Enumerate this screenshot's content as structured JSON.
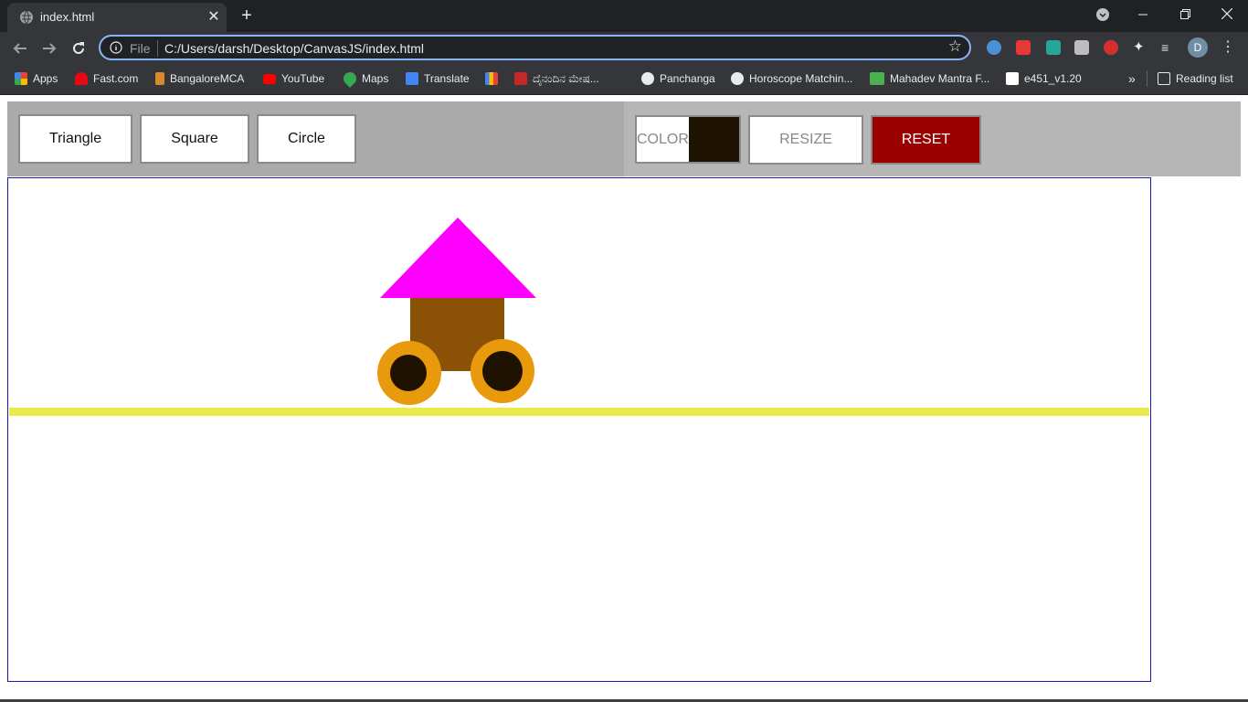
{
  "browser": {
    "tab_title": "index.html",
    "tab_close": "✕",
    "new_tab": "+",
    "omnibox_file_label": "File",
    "omnibox_url": "C:/Users/darsh/Desktop/CanvasJS/index.html",
    "avatar_letter": "D"
  },
  "bookmarks": [
    {
      "label": "Apps",
      "color": "#ea4335"
    },
    {
      "label": "Fast.com",
      "color": "#e50914"
    },
    {
      "label": "BangaloreMCA",
      "color": "#d9892b"
    },
    {
      "label": "YouTube",
      "color": "#ff0000"
    },
    {
      "label": "Maps",
      "color": "#34a853"
    },
    {
      "label": "Translate",
      "color": "#4285f4"
    },
    {
      "label": "",
      "color": "#fbbc04"
    },
    {
      "label": "ದೈನಂದಿನ ಮೇಷ...",
      "color": "#c62828"
    },
    {
      "label": "Panchanga",
      "color": "#e8eaed"
    },
    {
      "label": "Horoscope Matchin...",
      "color": "#e8eaed"
    },
    {
      "label": "Mahadev Mantra F...",
      "color": "#4caf50"
    },
    {
      "label": "e451_v1.20",
      "color": "#ffffff"
    }
  ],
  "bookmarks_more": "»",
  "reading_list": "Reading list",
  "controls": {
    "triangle_label": "Triangle",
    "square_label": "Square",
    "circle_label": "Circle",
    "color_label": "COLOR",
    "color_value": "#1e1200",
    "resize_label": "RESIZE",
    "reset_label": "RESET",
    "reset_color": "#9b0000"
  },
  "scene": {
    "roof_color": "#ff00ff",
    "body_color": "#8b5106",
    "wheel_outer_color": "#e89a0c",
    "wheel_inner_color": "#1e1200",
    "ground_color": "#eaea4a"
  }
}
